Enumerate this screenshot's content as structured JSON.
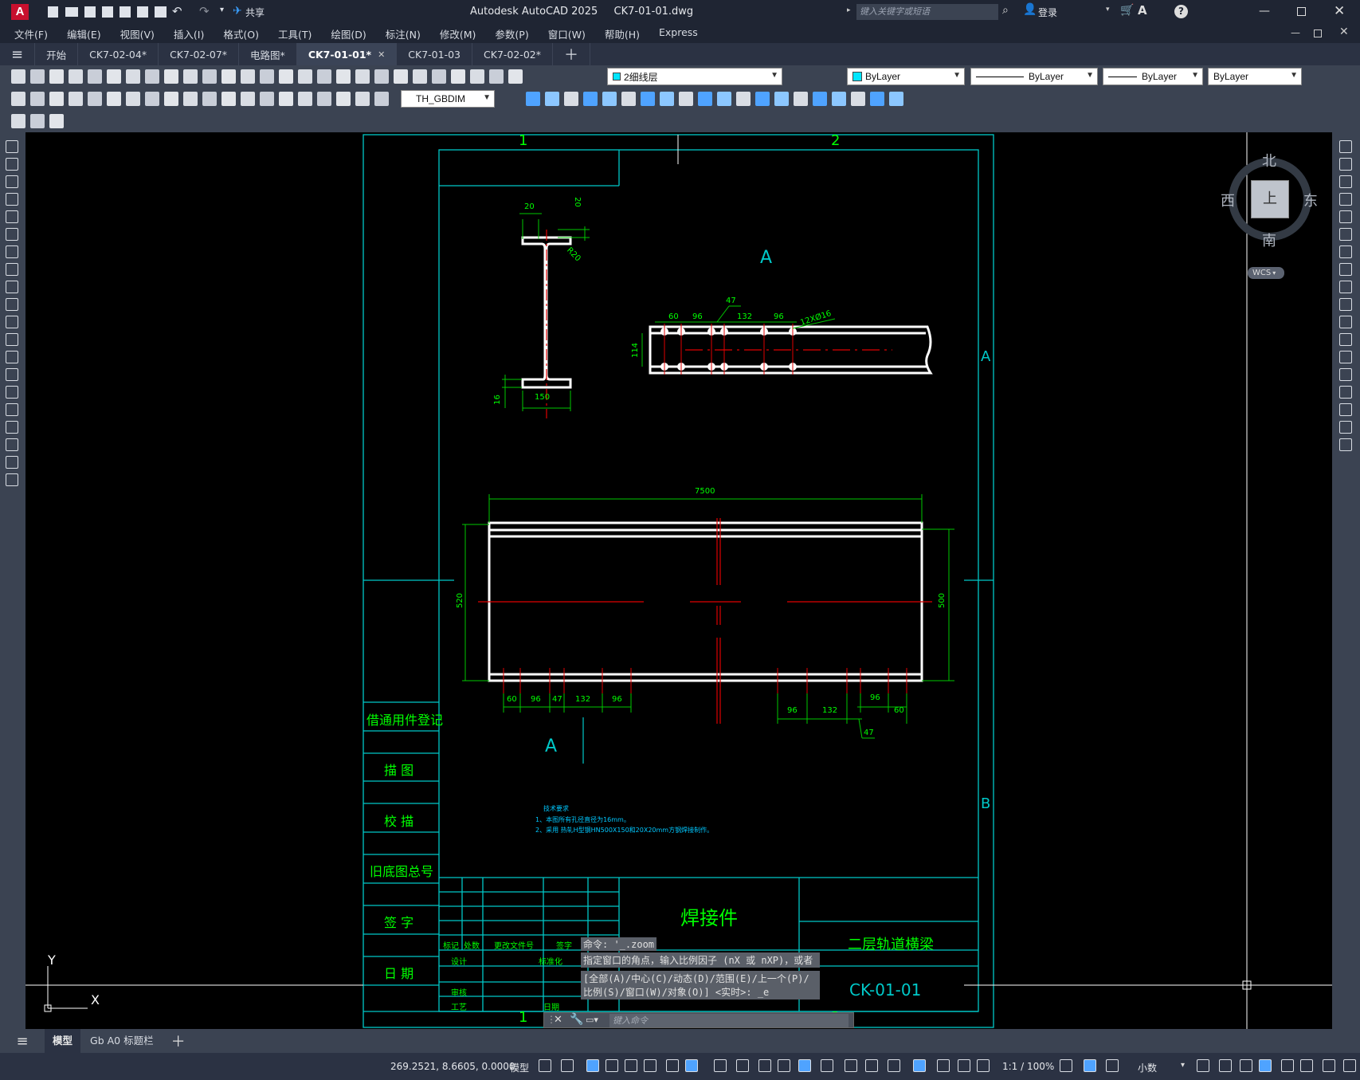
{
  "app": {
    "title": "Autodesk AutoCAD 2025",
    "filename": "CK7-01-01.dwg",
    "share_label": "共享",
    "search_placeholder": "键入关键字或短语",
    "login_label": "登录"
  },
  "menu": [
    "文件(F)",
    "编辑(E)",
    "视图(V)",
    "插入(I)",
    "格式(O)",
    "工具(T)",
    "绘图(D)",
    "标注(N)",
    "修改(M)",
    "参数(P)",
    "窗口(W)",
    "帮助(H)",
    "Express"
  ],
  "doc_tabs": [
    {
      "label": "开始",
      "active": false,
      "closable": false
    },
    {
      "label": "CK7-02-04*",
      "active": false,
      "closable": false
    },
    {
      "label": "CK7-02-07*",
      "active": false,
      "closable": false
    },
    {
      "label": "电路图*",
      "active": false,
      "closable": false
    },
    {
      "label": "CK7-01-01*",
      "active": true,
      "closable": true
    },
    {
      "label": "CK7-01-03",
      "active": false,
      "closable": false
    },
    {
      "label": "CK7-02-02*",
      "active": false,
      "closable": false
    }
  ],
  "toolbar": {
    "layer_name": "2细线层",
    "color": "ByLayer",
    "linetype": "ByLayer",
    "lineweight": "ByLayer",
    "plotstyle": "ByLayer",
    "dimstyle": "TH_GBDIM"
  },
  "viewcube": {
    "north": "北",
    "south": "南",
    "east": "东",
    "west": "西",
    "top": "上",
    "wcs": "WCS"
  },
  "ucs": {
    "x": "X",
    "y": "Y"
  },
  "drawing": {
    "grid_cols": [
      "1",
      "2"
    ],
    "grid_rows": [
      "A",
      "B"
    ],
    "section_label": "A",
    "section_label2": "A",
    "dims_ibeam": {
      "flange": "20",
      "flange_t": "20",
      "radius": "R20",
      "width": "150",
      "bottom": "16"
    },
    "dims_topview": {
      "a": "60",
      "b": "96",
      "c": "47",
      "d": "132",
      "e": "96",
      "holes": "12XØ16",
      "height": "114"
    },
    "dims_front": {
      "length": "7500",
      "left_h": "520",
      "right_h": "500"
    },
    "dims_bottom_left": [
      "60",
      "96",
      "47",
      "132",
      "96"
    ],
    "dims_bottom_right": [
      "96",
      "132",
      "96",
      "60",
      "47"
    ],
    "notes_title": "技术要求",
    "notes": [
      "1、本图所有孔径直径为16mm。",
      "2、采用 热轧H型钢HN500X150和20X20mm方钢焊接制作。"
    ],
    "side_labels": [
      "借通用件登记",
      "描  图",
      "校  描",
      "旧底图总号",
      "签  字",
      "日  期"
    ],
    "titleblock": {
      "name": "焊接件",
      "project": "二层轨道横梁",
      "drawing_no": "CK-01-01",
      "row_labels": [
        "标记",
        "处数",
        "更改文件号",
        "签字",
        "设计",
        "标准化",
        "审核",
        "工艺",
        "日期"
      ]
    }
  },
  "command": {
    "history": [
      "命令: '_.zoom",
      "指定窗口的角点，输入比例因子 (nX 或 nXP)，或者",
      "[全部(A)/中心(C)/动态(D)/范围(E)/上一个(P)/比例(S)/窗口(W)/对象(O)] <实时>: _e"
    ],
    "placeholder": "键入命令"
  },
  "layout_tabs": [
    "模型",
    "Gb A0 标题栏"
  ],
  "status": {
    "coords": "269.2521, 8.6605, 0.0000",
    "space": "模型",
    "scale": "1:1 / 100%",
    "units": "小数"
  }
}
